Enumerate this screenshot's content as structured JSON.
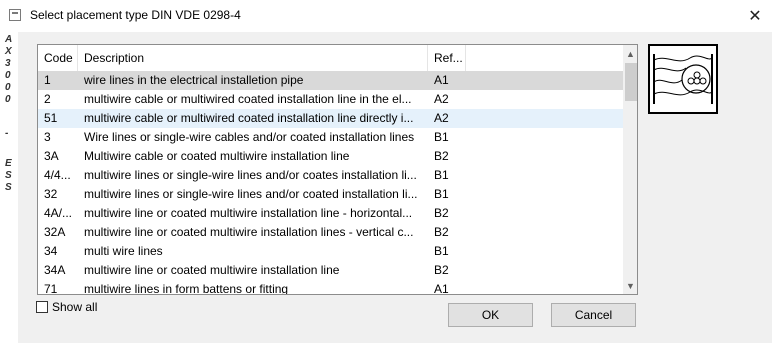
{
  "window": {
    "title": "Select placement type DIN VDE 0298-4",
    "close_label": "✕"
  },
  "side_rail": {
    "top_letters": [
      "A",
      "X",
      "3",
      "0",
      "0",
      "0"
    ],
    "dash": "-",
    "bottom_letters": [
      "E",
      "S",
      "S"
    ]
  },
  "table": {
    "columns": {
      "code": "Code",
      "description": "Description",
      "ref": "Ref..."
    },
    "rows": [
      {
        "code": "1",
        "description": "wire lines in the electrical installetion pipe",
        "ref": "A1"
      },
      {
        "code": "2",
        "description": "multiwire cable or multiwired coated installation line in the el...",
        "ref": "A2"
      },
      {
        "code": "51",
        "description": "multiwire cable or multiwired coated installation line directly i...",
        "ref": "A2"
      },
      {
        "code": "3",
        "description": "Wire lines or single-wire cables and/or coated installation lines",
        "ref": "B1"
      },
      {
        "code": "3A",
        "description": "Multiwire cable or coated multiwire installation line",
        "ref": "B2"
      },
      {
        "code": "4/4...",
        "description": "multiwire lines or single-wire lines and/or coates installation li...",
        "ref": "B1"
      },
      {
        "code": "32",
        "description": "multiwire lines or single-wire lines and/or coated installation li...",
        "ref": "B1"
      },
      {
        "code": "4A/...",
        "description": "multiwire line or coated multiwire installation line - horizontal...",
        "ref": "B2"
      },
      {
        "code": "32A",
        "description": "multiwire line or coated multiwire installation lines - vertical c...",
        "ref": "B2"
      },
      {
        "code": "34",
        "description": "multi wire lines",
        "ref": "B1"
      },
      {
        "code": "34A",
        "description": "multiwire line or coated multiwire installation line",
        "ref": "B2"
      },
      {
        "code": "71",
        "description": "multiwire lines in form battens or fitting",
        "ref": "A1"
      }
    ],
    "selected_row": 0,
    "hover_row": 2
  },
  "preview": {
    "icon": "cable-in-pipe-diagram"
  },
  "show_all": {
    "label": "Show all",
    "checked": false
  },
  "buttons": {
    "ok": "OK",
    "cancel": "Cancel"
  }
}
